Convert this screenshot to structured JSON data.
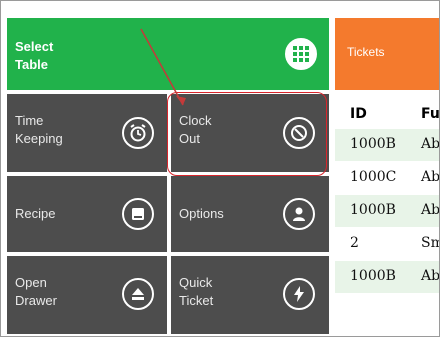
{
  "tiles": {
    "select_table": {
      "label": "Select\nTable",
      "icon": "grid-icon"
    },
    "time_keeping": {
      "label": "Time\nKeeping",
      "icon": "alarm-clock-icon"
    },
    "clock_out": {
      "label": "Clock\nOut",
      "icon": "no-entry-icon"
    },
    "recipe": {
      "label": "Recipe",
      "icon": "recipe-book-icon"
    },
    "options": {
      "label": "Options",
      "icon": "user-icon"
    },
    "open_drawer": {
      "label": "Open\nDrawer",
      "icon": "eject-icon"
    },
    "quick_ticket": {
      "label": "Quick\nTicket",
      "icon": "lightning-icon"
    }
  },
  "tickets": {
    "title": "Tickets",
    "columns": [
      "ID",
      "Fu"
    ],
    "rows": [
      {
        "id": "1000B",
        "name": "Ab"
      },
      {
        "id": "1000C",
        "name": "Ab"
      },
      {
        "id": "1000B",
        "name": "Ab"
      },
      {
        "id": "2",
        "name": "Sm"
      },
      {
        "id": "1000B",
        "name": "Ab"
      }
    ]
  },
  "colors": {
    "green": "#21b24b",
    "tile": "#4d4d4d",
    "orange": "#f47a2d",
    "highlight": "#d7262c"
  }
}
